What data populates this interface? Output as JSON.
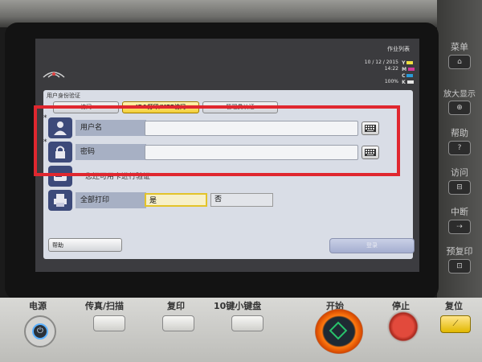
{
  "screen": {
    "job_list": "作业列表",
    "date": "10 / 12 / 2015",
    "time": "14:22",
    "memory": "100%",
    "toner": [
      {
        "letter": "Y",
        "color": "#f0e040"
      },
      {
        "letter": "M",
        "color": "#d03a9a"
      },
      {
        "letter": "C",
        "color": "#2a9ad8"
      },
      {
        "letter": "K",
        "color": "#e6e6e6"
      }
    ]
  },
  "auth": {
    "title": "用户身份验证",
    "tabs": [
      "访问",
      "ID&打印/MFP访问",
      "管理员认证"
    ],
    "username_label": "用户名",
    "password_label": "密码",
    "note": "您还可用卡进行验证",
    "print_all_label": "全部打印",
    "yes_label": "是",
    "no_label": "否",
    "help_label": "帮助",
    "ok_label": "登录",
    "required_mark": "*"
  },
  "side_panel": {
    "buttons": [
      {
        "label": "菜单",
        "icon": "home-icon"
      },
      {
        "label": "放大显示",
        "icon": "zoom-icon"
      },
      {
        "label": "帮助",
        "icon": "question-icon"
      },
      {
        "label": "访问",
        "icon": "access-icon"
      },
      {
        "label": "中断",
        "icon": "interrupt-icon"
      },
      {
        "label": "预复印",
        "icon": "preview-icon"
      }
    ]
  },
  "bottom_panel": {
    "power": "电源",
    "fax_scan": "传真/扫描",
    "copy": "复印",
    "keypad": "10键小键盘",
    "start": "开始",
    "stop": "停止",
    "reset": "复位"
  }
}
